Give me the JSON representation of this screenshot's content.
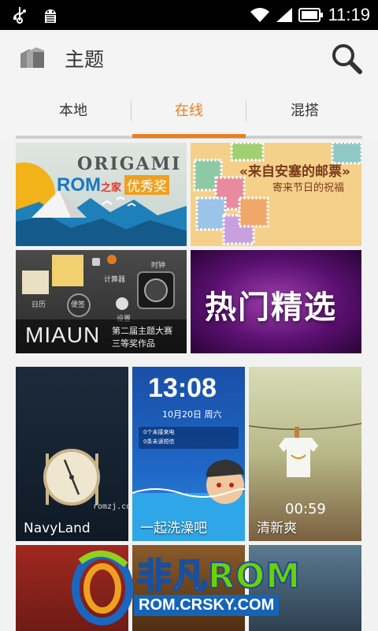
{
  "status_bar": {
    "time": "11:19",
    "icons": [
      "usb-icon",
      "android-debug-icon",
      "wifi-icon",
      "signal-icon",
      "battery-icon"
    ]
  },
  "header": {
    "title": "主题",
    "app_icon": "theme-icon",
    "search_icon": "search-icon"
  },
  "tabs": [
    {
      "label": "本地",
      "active": false
    },
    {
      "label": "在线",
      "active": true
    },
    {
      "label": "混搭",
      "active": false
    }
  ],
  "colors": {
    "accent": "#f07d1a",
    "header_bg": "#f4f4f4",
    "status_bg": "#000000"
  },
  "banners": [
    {
      "name": "origami",
      "title": "ORIGAMI",
      "badge_rom": "ROM",
      "badge_zhijia": "之家",
      "badge_award": "优秀奖"
    },
    {
      "name": "stamps",
      "title": "«来自安塞的邮票»",
      "subtitle": "寄来节日的祝福"
    },
    {
      "name": "miaun",
      "title": "MIAUN",
      "subtitle_1": "第二届主题大赛",
      "subtitle_2": "三等奖作品",
      "labels": [
        "日历",
        "便签",
        "计算器",
        "时钟",
        "设置"
      ]
    },
    {
      "name": "hot",
      "title": "热门精选"
    }
  ],
  "themes": [
    {
      "label": "NavyLand",
      "watermark": "romzj.com"
    },
    {
      "label": "一起洗澡吧",
      "clock": "13:08",
      "date": "10月20日 周六",
      "notices": [
        "0个未接来电",
        "0条未读短信"
      ]
    },
    {
      "label": "清新爽",
      "clock": "00:59"
    }
  ],
  "watermark": {
    "title_a": "非凡",
    "title_b": "ROM",
    "url": "ROM.CRSKY.COM"
  }
}
